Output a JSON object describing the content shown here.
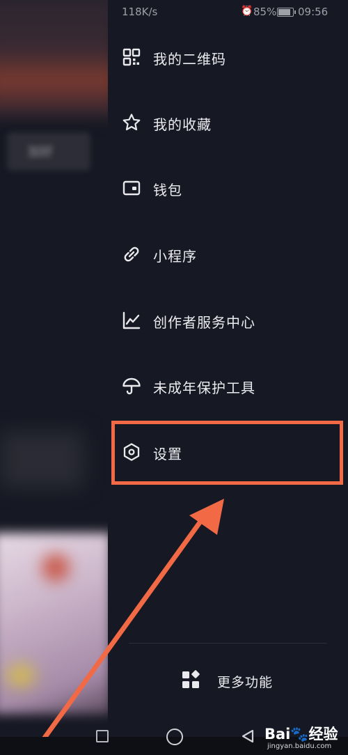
{
  "status_bar": {
    "network_speed": "118K/s",
    "battery_percent": "85%",
    "time": "09:56"
  },
  "background": {
    "blurred_button_text": "加好"
  },
  "drawer": {
    "items": [
      {
        "label": "我的二维码",
        "icon": "qr-code-icon"
      },
      {
        "label": "我的收藏",
        "icon": "star-icon"
      },
      {
        "label": "钱包",
        "icon": "wallet-icon"
      },
      {
        "label": "小程序",
        "icon": "link-icon"
      },
      {
        "label": "创作者服务中心",
        "icon": "chart-line-icon"
      },
      {
        "label": "未成年保护工具",
        "icon": "umbrella-icon"
      },
      {
        "label": "设置",
        "icon": "hexagon-settings-icon"
      }
    ],
    "more_functions": {
      "label": "更多功能",
      "icon": "apps-grid-icon"
    }
  },
  "annotation": {
    "highlight_color": "#f26a45",
    "target": "设置"
  },
  "watermark": {
    "brand": "Bai",
    "brand_suffix": "经验",
    "url": "jingyan.baidu.com"
  }
}
